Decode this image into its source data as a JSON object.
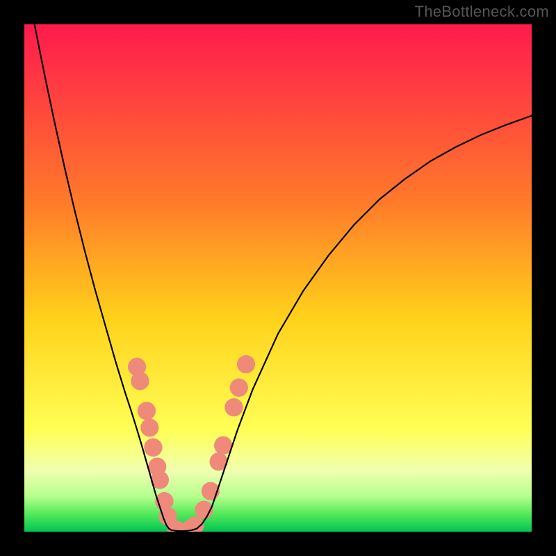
{
  "watermark": "TheBottleneck.com",
  "chart_data": {
    "type": "line",
    "title": "",
    "xlabel": "",
    "ylabel": "",
    "xlim": [
      0,
      100
    ],
    "ylim": [
      0,
      100
    ],
    "background_gradient": {
      "orientation": "vertical",
      "stops": [
        {
          "offset": 0.0,
          "color": "#ff1a4d"
        },
        {
          "offset": 0.35,
          "color": "#ff7a2a"
        },
        {
          "offset": 0.58,
          "color": "#ffd21a"
        },
        {
          "offset": 0.8,
          "color": "#ffff55"
        },
        {
          "offset": 0.88,
          "color": "#f0ffb0"
        },
        {
          "offset": 0.93,
          "color": "#b6ff8e"
        },
        {
          "offset": 0.965,
          "color": "#55e95a"
        },
        {
          "offset": 1.0,
          "color": "#00c552"
        }
      ]
    },
    "series": [
      {
        "name": "left-branch",
        "stroke": "#000000",
        "x": [
          2,
          4,
          6,
          8,
          10,
          12,
          14,
          16,
          18,
          20,
          21,
          22,
          23,
          24,
          25,
          26,
          27,
          27.5,
          28,
          28.5
        ],
        "y": [
          100,
          90,
          80.5,
          71.5,
          63,
          55,
          47.5,
          40.5,
          33.5,
          27,
          24,
          20.8,
          17.5,
          14,
          10.5,
          7,
          4,
          2.5,
          1.3,
          0.6
        ]
      },
      {
        "name": "valley-floor",
        "stroke": "#000000",
        "x": [
          28.5,
          29,
          30,
          31,
          32,
          33,
          34
        ],
        "y": [
          0.6,
          0.3,
          0.15,
          0.1,
          0.15,
          0.3,
          0.6
        ]
      },
      {
        "name": "right-branch",
        "stroke": "#000000",
        "x": [
          34,
          35,
          36,
          37,
          38,
          40,
          42,
          45,
          50,
          55,
          60,
          65,
          70,
          75,
          80,
          85,
          90,
          95,
          100
        ],
        "y": [
          0.6,
          1.5,
          3,
          5,
          8,
          14,
          20,
          28,
          39,
          47.5,
          54.5,
          60.5,
          65.5,
          69.5,
          73,
          75.8,
          78.2,
          80.2,
          82
        ]
      }
    ],
    "markers": {
      "name": "highlighted-points",
      "color": "#ef8a7a",
      "radius_ratio": 0.018,
      "points": [
        {
          "x": 22.2,
          "y": 32.5
        },
        {
          "x": 22.8,
          "y": 29.7
        },
        {
          "x": 24.1,
          "y": 23.8
        },
        {
          "x": 24.7,
          "y": 20.5
        },
        {
          "x": 25.4,
          "y": 16.6
        },
        {
          "x": 26.2,
          "y": 12.8
        },
        {
          "x": 26.7,
          "y": 10.2
        },
        {
          "x": 27.6,
          "y": 6.0
        },
        {
          "x": 28.3,
          "y": 3.0
        },
        {
          "x": 30.0,
          "y": 0.4
        },
        {
          "x": 32.6,
          "y": 0.5
        },
        {
          "x": 33.6,
          "y": 1.2
        },
        {
          "x": 35.4,
          "y": 4.3
        },
        {
          "x": 36.7,
          "y": 8.0
        },
        {
          "x": 38.3,
          "y": 13.8
        },
        {
          "x": 39.2,
          "y": 17.0
        },
        {
          "x": 41.3,
          "y": 24.5
        },
        {
          "x": 42.3,
          "y": 28.4
        },
        {
          "x": 43.7,
          "y": 33.0
        }
      ]
    }
  }
}
